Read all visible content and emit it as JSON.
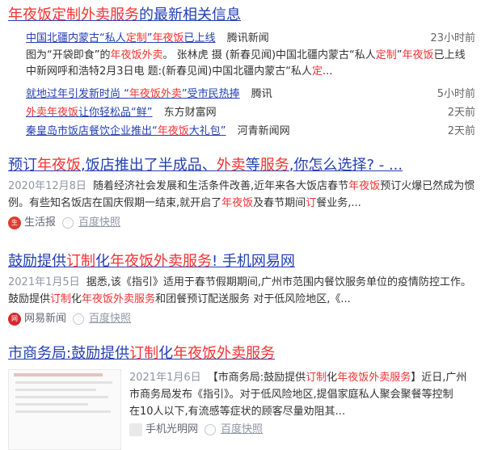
{
  "news": {
    "title": "年夜饭定制外卖服务的最新相关信息",
    "items": [
      {
        "title": "中国北疆内蒙古“私人定制”年夜饭已上线",
        "source": "腾讯新闻",
        "time": "23小时前",
        "abstract_line1": "图为“开袋即食”的年夜饭外卖。 张林虎 摄 (新春见闻)中国北疆内蒙古“私人定制”年夜饭已上线",
        "abstract_line2": "中新网呼和浩特2月3日电 题:(新春见闻)中国北疆内蒙古“私人定..."
      },
      {
        "title": "就地过年引发新时尚 “年夜饭外卖”受市民热捧",
        "source": "腾讯",
        "time": "5小时前"
      },
      {
        "title": "外卖年夜饭让你轻松品“鲜”",
        "source": "东方财富网",
        "time": "2天前"
      },
      {
        "title": "秦皇岛市饭店餐饮企业推出“年夜饭大礼包”",
        "source": "河青新闻网",
        "time": "2天前"
      }
    ]
  },
  "results": [
    {
      "title": "预订年夜饭,饭店推出了半成品、外卖等服务,你怎么选择? - ...",
      "date": "2020年12月8日",
      "abstract": "随着经济社会发展和生活条件改善,近年来各大饭店春节年夜饭预订火爆已然成为惯例。有些知名饭店在国庆假期一结束,就开启了年夜饭及春节期间订餐业务,...",
      "source": "生活报",
      "snapshot": "百度快照",
      "icon_color": "#e03b2f"
    },
    {
      "title": "鼓励提供订制化年夜饭外卖服务! 手机网易网",
      "date": "2021年1月5日",
      "abstract": "据悉,该《指引》适用于春节假期期间,广州市范围内餐饮服务单位的疫情防控工作。 鼓励提供订制化年夜饭外卖服务和团餐预订配送服务 对于低风险地区,《...",
      "source": "网易新闻",
      "snapshot": "百度快照",
      "icon_color": "#d6282b"
    },
    {
      "title": "市商务局:鼓励提供订制化年夜饭外卖服务",
      "date": "2021年1月6日",
      "abstract_line1": "【市商务局:鼓励提供订制化年夜饭外卖服务】近日,广州",
      "abstract_line2": "市商务局发布《指引》。对于低风险地区,提倡家庭私人聚会聚餐等控制",
      "abstract_line3": "在10人以下,有流感等症状的顾客尽量劝阻其...",
      "source": "手机光明网",
      "snapshot": "百度快照"
    }
  ],
  "colors": {
    "link": "#2440b3",
    "highlight": "#f73131",
    "gray": "#9195a3"
  },
  "icons": [
    "favorite-icon",
    "source-logo-icon"
  ]
}
